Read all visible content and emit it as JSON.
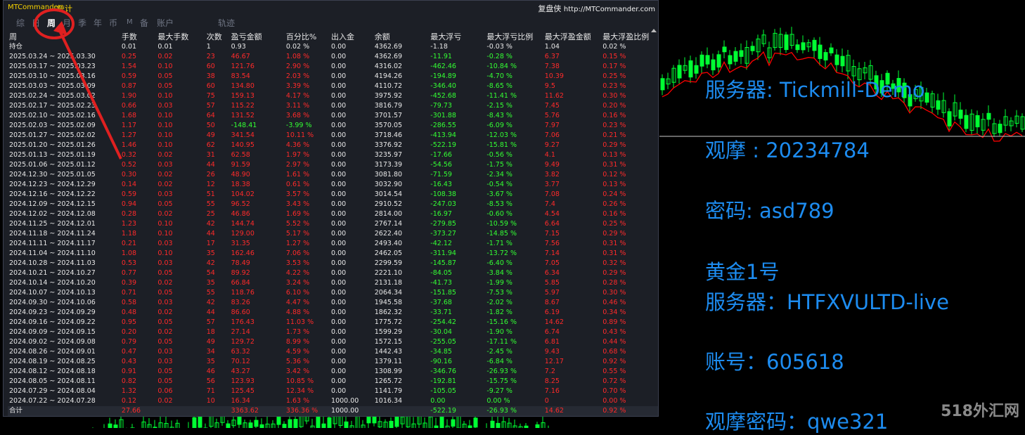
{
  "window": {
    "app_name": "MTCommander",
    "title_tab": "统计",
    "review_label": "复盘侠",
    "review_url": "http://MTCommander.com"
  },
  "tabs": [
    {
      "label": "综",
      "active": false
    },
    {
      "label": "日",
      "active": false
    },
    {
      "label": "周",
      "active": true
    },
    {
      "label": "月",
      "active": false
    },
    {
      "label": "季",
      "active": false
    },
    {
      "label": "年",
      "active": false
    },
    {
      "label": "币",
      "active": false
    },
    {
      "label": "M",
      "active": false
    },
    {
      "label": "备",
      "active": false
    },
    {
      "label": "账户",
      "active": false
    },
    {
      "label": "轨迹",
      "active": false
    }
  ],
  "table": {
    "headers": [
      "周",
      "手数",
      "最大手数",
      "次数",
      "盈亏金额",
      "百分比%",
      "出入金",
      "余额",
      "最大浮亏",
      "最大浮亏比例",
      "最大浮盈金额",
      "最大浮盈比例"
    ],
    "hold_row": [
      "持仓",
      "0.01",
      "0.01",
      "1",
      "0.93",
      "0.02 %",
      "0.00",
      "4362.69",
      "-1.18",
      "-0.03 %",
      "1.04",
      "0.02 %"
    ],
    "rows": [
      [
        "2025.03.24 ~ 2025.03.30",
        "0.25",
        "0.02",
        "23",
        "46.67",
        "1.08 %",
        "0.00",
        "4362.69",
        "-11.91",
        "-0.28 %",
        "6.37",
        "0.15 %"
      ],
      [
        "2025.03.17 ~ 2025.03.23",
        "1.54",
        "0.10",
        "60",
        "121.76",
        "2.90 %",
        "0.00",
        "4316.02",
        "-462.46",
        "-10.84 %",
        "7.38",
        "0.17 %"
      ],
      [
        "2025.03.10 ~ 2025.03.16",
        "0.59",
        "0.05",
        "38",
        "83.54",
        "2.03 %",
        "0.00",
        "4194.26",
        "-194.89",
        "-4.70 %",
        "10.39",
        "0.25 %"
      ],
      [
        "2025.03.03 ~ 2025.03.09",
        "0.87",
        "0.05",
        "60",
        "134.80",
        "3.39 %",
        "0.00",
        "4110.72",
        "-346.40",
        "-8.65 %",
        "9.5",
        "0.23 %"
      ],
      [
        "2025.02.24 ~ 2025.03.02",
        "1.90",
        "0.10",
        "75",
        "159.13",
        "4.17 %",
        "0.00",
        "3975.92",
        "-452.68",
        "-11.41 %",
        "11.62",
        "0.30 %"
      ],
      [
        "2025.02.17 ~ 2025.02.23",
        "0.66",
        "0.03",
        "57",
        "115.22",
        "3.11 %",
        "0.00",
        "3816.79",
        "-79.73",
        "-2.15 %",
        "7.45",
        "0.20 %"
      ],
      [
        "2025.02.10 ~ 2025.02.16",
        "1.68",
        "0.10",
        "64",
        "131.52",
        "3.68 %",
        "0.00",
        "3701.57",
        "-301.88",
        "-8.43 %",
        "5.76",
        "0.16 %"
      ],
      [
        "2025.02.03 ~ 2025.02.09",
        "1.17",
        "0.10",
        "50",
        "-148.41",
        "-3.99 %",
        "0.00",
        "3570.05",
        "-286.55",
        "-6.09 %",
        "7.97",
        "0.23 %"
      ],
      [
        "2025.01.27 ~ 2025.02.02",
        "1.27",
        "0.10",
        "49",
        "341.54",
        "10.11 %",
        "0.00",
        "3718.46",
        "-413.94",
        "-12.03 %",
        "7.06",
        "0.21 %"
      ],
      [
        "2025.01.20 ~ 2025.01.26",
        "1.46",
        "0.10",
        "62",
        "140.95",
        "4.36 %",
        "0.00",
        "3376.92",
        "-522.19",
        "-15.81 %",
        "9.27",
        "0.29 %"
      ],
      [
        "2025.01.13 ~ 2025.01.19",
        "0.32",
        "0.02",
        "31",
        "62.58",
        "1.97 %",
        "0.00",
        "3235.97",
        "-17.66",
        "-0.56 %",
        "4.1",
        "0.13 %"
      ],
      [
        "2025.01.06 ~ 2025.01.12",
        "0.52",
        "0.03",
        "44",
        "91.59",
        "2.97 %",
        "0.00",
        "3173.39",
        "-54.56",
        "-1.75 %",
        "9.49",
        "0.31 %"
      ],
      [
        "2024.12.30 ~ 2025.01.05",
        "0.30",
        "0.02",
        "26",
        "48.90",
        "1.61 %",
        "0.00",
        "3081.80",
        "-71.59",
        "-2.34 %",
        "3.82",
        "0.12 %"
      ],
      [
        "2024.12.23 ~ 2024.12.29",
        "0.14",
        "0.02",
        "12",
        "18.38",
        "0.61 %",
        "0.00",
        "3032.90",
        "-16.43",
        "-0.54 %",
        "3.77",
        "0.13 %"
      ],
      [
        "2024.12.16 ~ 2024.12.22",
        "0.59",
        "0.03",
        "51",
        "104.02",
        "3.57 %",
        "0.00",
        "3014.54",
        "-108.38",
        "-3.67 %",
        "7.08",
        "0.24 %"
      ],
      [
        "2024.12.09 ~ 2024.12.15",
        "0.94",
        "0.05",
        "55",
        "96.52",
        "3.43 %",
        "0.00",
        "2910.52",
        "-247.03",
        "-8.53 %",
        "7.4",
        "0.26 %"
      ],
      [
        "2024.12.02 ~ 2024.12.08",
        "0.28",
        "0.02",
        "25",
        "46.86",
        "1.69 %",
        "0.00",
        "2814.00",
        "-16.97",
        "-0.60 %",
        "4.54",
        "0.16 %"
      ],
      [
        "2024.11.25 ~ 2024.12.01",
        "1.23",
        "0.10",
        "42",
        "144.74",
        "5.52 %",
        "0.00",
        "2767.14",
        "-279.85",
        "-10.59 %",
        "6.64",
        "0.25 %"
      ],
      [
        "2024.11.18 ~ 2024.11.24",
        "1.18",
        "0.10",
        "44",
        "129.00",
        "5.17 %",
        "0.00",
        "2622.40",
        "-373.27",
        "-14.85 %",
        "7.15",
        "0.29 %"
      ],
      [
        "2024.11.11 ~ 2024.11.17",
        "0.21",
        "0.03",
        "17",
        "31.35",
        "1.27 %",
        "0.00",
        "2493.40",
        "-42.12",
        "-1.71 %",
        "7.56",
        "0.31 %"
      ],
      [
        "2024.11.04 ~ 2024.11.10",
        "1.08",
        "0.10",
        "35",
        "162.46",
        "7.06 %",
        "0.00",
        "2462.05",
        "-311.94",
        "-13.72 %",
        "7.14",
        "0.31 %"
      ],
      [
        "2024.10.28 ~ 2024.11.03",
        "0.53",
        "0.03",
        "42",
        "78.49",
        "3.53 %",
        "0.00",
        "2299.59",
        "-145.87",
        "-6.40 %",
        "7.05",
        "0.32 %"
      ],
      [
        "2024.10.21 ~ 2024.10.27",
        "0.77",
        "0.05",
        "54",
        "89.92",
        "4.22 %",
        "0.00",
        "2221.10",
        "-84.05",
        "-3.84 %",
        "6.34",
        "0.29 %"
      ],
      [
        "2024.10.14 ~ 2024.10.20",
        "0.39",
        "0.02",
        "35",
        "66.84",
        "3.24 %",
        "0.00",
        "2131.18",
        "-41.73",
        "-1.99 %",
        "5.85",
        "0.28 %"
      ],
      [
        "2024.10.07 ~ 2024.10.13",
        "0.71",
        "0.05",
        "55",
        "118.76",
        "6.10 %",
        "0.00",
        "2064.34",
        "-151.85",
        "-7.53 %",
        "5.97",
        "0.30 %"
      ],
      [
        "2024.09.30 ~ 2024.10.06",
        "0.58",
        "0.03",
        "42",
        "83.26",
        "4.47 %",
        "0.00",
        "1945.58",
        "-37.68",
        "-2.02 %",
        "8.67",
        "0.46 %"
      ],
      [
        "2024.09.23 ~ 2024.09.29",
        "0.48",
        "0.02",
        "44",
        "86.60",
        "4.88 %",
        "0.00",
        "1862.32",
        "-33.71",
        "-1.82 %",
        "6.19",
        "0.34 %"
      ],
      [
        "2024.09.16 ~ 2024.09.22",
        "0.95",
        "0.05",
        "57",
        "176.43",
        "11.03 %",
        "0.00",
        "1775.72",
        "-254.42",
        "-15.16 %",
        "14.62",
        "0.89 %"
      ],
      [
        "2024.09.09 ~ 2024.09.15",
        "0.20",
        "0.02",
        "18",
        "27.14",
        "1.73 %",
        "0.00",
        "1599.29",
        "-30.04",
        "-1.90 %",
        "6.74",
        "0.43 %"
      ],
      [
        "2024.09.02 ~ 2024.09.08",
        "0.79",
        "0.05",
        "49",
        "129.72",
        "8.99 %",
        "0.00",
        "1572.15",
        "-255.05",
        "-17.11 %",
        "6.81",
        "0.44 %"
      ],
      [
        "2024.08.26 ~ 2024.09.01",
        "0.47",
        "0.03",
        "34",
        "63.32",
        "4.59 %",
        "0.00",
        "1442.43",
        "-34.85",
        "-2.45 %",
        "9.43",
        "0.68 %"
      ],
      [
        "2024.08.19 ~ 2024.08.25",
        "0.43",
        "0.03",
        "35",
        "70.12",
        "5.36 %",
        "0.00",
        "1379.11",
        "-90.16",
        "-6.84 %",
        "12.17",
        "0.92 %"
      ],
      [
        "2024.08.12 ~ 2024.08.18",
        "0.91",
        "0.05",
        "46",
        "43.27",
        "3.42 %",
        "0.00",
        "1308.99",
        "-346.76",
        "-26.93 %",
        "7.2",
        "0.55 %"
      ],
      [
        "2024.08.05 ~ 2024.08.11",
        "0.82",
        "0.05",
        "56",
        "123.93",
        "10.85 %",
        "0.00",
        "1265.72",
        "-192.81",
        "-15.75 %",
        "8.25",
        "0.72 %"
      ],
      [
        "2024.07.29 ~ 2024.08.04",
        "1.32",
        "0.06",
        "71",
        "125.45",
        "12.34 %",
        "0.00",
        "1141.79",
        "-105.05",
        "-9.27 %",
        "7.16",
        "0.70 %"
      ],
      [
        "2024.07.22 ~ 2024.07.28",
        "0.12",
        "0.02",
        "10",
        "16.34",
        "1.63 %",
        "1000.00",
        "1016.34",
        "0.00",
        "0.00 %",
        "0",
        "0.00 %"
      ]
    ],
    "total_row": [
      "合计",
      "27.66",
      "",
      "",
      "3363.62",
      "336.36 %",
      "1000.00",
      "",
      "-522.19",
      "-26.93 %",
      "14.62",
      "0.92 %"
    ]
  },
  "info": {
    "line1": "服务器: Tickmill-Demo",
    "line2": "观摩 : 20234784",
    "line3": "密码: asd789",
    "line4": "黄金1号",
    "line5": "服务器：HTFXVULTD-live",
    "line6": "账号：605618",
    "line7": "观摩密码：qwe321"
  },
  "watermark": "518外汇网",
  "colors": {
    "profit": "#ff2a2a",
    "loss": "#33ff33",
    "info_text": "#1d8cf0",
    "candle_up": "#00ff33",
    "ma_line": "#ff0000",
    "title": "#f5d100"
  }
}
